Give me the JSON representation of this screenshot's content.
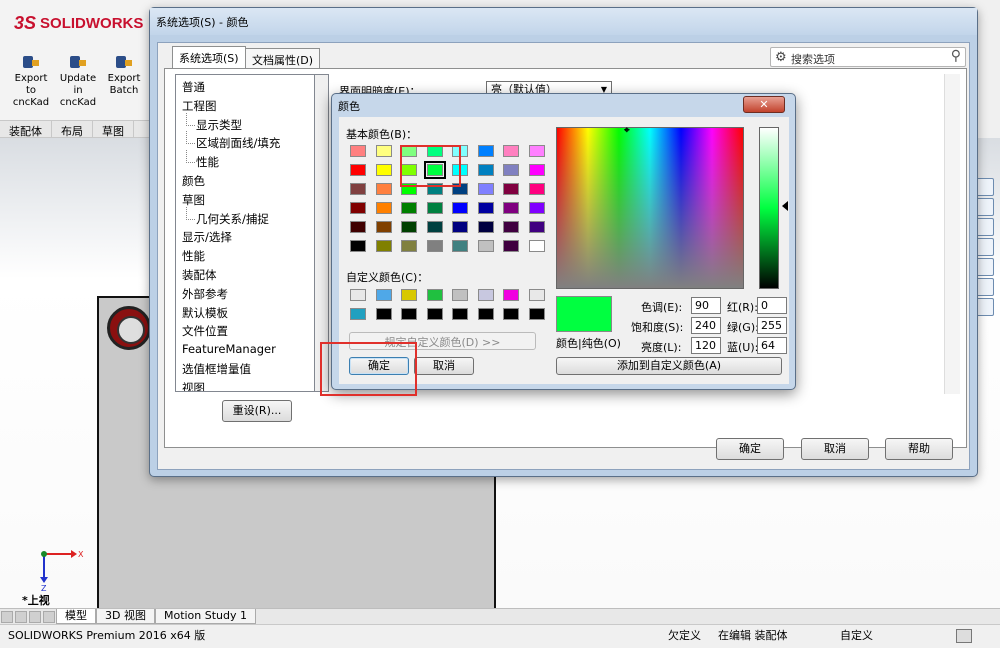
{
  "app": {
    "logo": "SOLIDWORKS",
    "logo_mark": "3S",
    "ribbon_buttons": [
      "Export to cncKad",
      "Update in cncKad",
      "Export Batch"
    ],
    "command_tabs": [
      "装配体",
      "布局",
      "草图"
    ],
    "view_label": "*上视",
    "triad_x": "X",
    "triad_z": "Z",
    "bottom_tabs": [
      "模型",
      "3D 视图",
      "Motion Study 1"
    ],
    "status": {
      "product": "SOLIDWORKS Premium 2016 x64 版",
      "defined": "欠定义",
      "editing": "在编辑 装配体",
      "custom": "自定义"
    }
  },
  "system_options": {
    "title": "系统选项(S) - 颜色",
    "tabs": [
      "系统选项(S)",
      "文档属性(D)"
    ],
    "search_placeholder": "搜索选项",
    "tree": [
      {
        "label": "普通",
        "sub": false
      },
      {
        "label": "工程图",
        "sub": false
      },
      {
        "label": "显示类型",
        "sub": true
      },
      {
        "label": "区域剖面线/填充",
        "sub": true
      },
      {
        "label": "性能",
        "sub": true
      },
      {
        "label": "颜色",
        "sub": false
      },
      {
        "label": "草图",
        "sub": false
      },
      {
        "label": "几何关系/捕捉",
        "sub": true
      },
      {
        "label": "显示/选择",
        "sub": false
      },
      {
        "label": "性能",
        "sub": false
      },
      {
        "label": "装配体",
        "sub": false
      },
      {
        "label": "外部参考",
        "sub": false
      },
      {
        "label": "默认模板",
        "sub": false
      },
      {
        "label": "文件位置",
        "sub": false
      },
      {
        "label": "FeatureManager",
        "sub": false
      },
      {
        "label": "选值框增量值",
        "sub": false
      },
      {
        "label": "视图",
        "sub": false
      }
    ],
    "brightness_label": "界面明暗度(E)：",
    "brightness_value": "亮（默认值）",
    "reset_button": "重设(R)...",
    "ok": "确定",
    "cancel": "取消",
    "help": "帮助"
  },
  "color_dialog": {
    "title": "颜色",
    "close": "✕",
    "basic_label": "基本颜色(B)：",
    "custom_label": "自定义颜色(C)：",
    "define_custom": "规定自定义颜色(D) >>",
    "ok": "确定",
    "cancel": "取消",
    "preview_label": "颜色|纯色(O)",
    "add_custom": "添加到自定义颜色(A)",
    "hue_label": "色调(E):",
    "hue": "90",
    "sat_label": "饱和度(S):",
    "sat": "240",
    "lum_label": "亮度(L):",
    "lum": "120",
    "red_label": "红(R):",
    "red": "0",
    "green_label": "绿(G):",
    "green": "255",
    "blue_label": "蓝(U):",
    "blue": "64",
    "selected_color": "#00ff40",
    "basic_colors": [
      [
        "#ff8080",
        "#ffff80",
        "#80ff80",
        "#00ff80",
        "#80ffff",
        "#0080ff",
        "#ff80c0",
        "#ff80ff"
      ],
      [
        "#ff0000",
        "#ffff00",
        "#80ff00",
        "#00ff40",
        "#00ffff",
        "#0080c0",
        "#8080c0",
        "#ff00ff"
      ],
      [
        "#804040",
        "#ff8040",
        "#00ff00",
        "#008080",
        "#004080",
        "#8080ff",
        "#800040",
        "#ff0080"
      ],
      [
        "#800000",
        "#ff8000",
        "#008000",
        "#008040",
        "#0000ff",
        "#0000a0",
        "#800080",
        "#8000ff"
      ],
      [
        "#400000",
        "#804000",
        "#004000",
        "#004040",
        "#000080",
        "#000040",
        "#400040",
        "#400080"
      ],
      [
        "#000000",
        "#808000",
        "#808040",
        "#808080",
        "#408080",
        "#c0c0c0",
        "#400040",
        "#ffffff"
      ]
    ],
    "custom_colors": [
      [
        "#e8e8e8",
        "#4fa8e8",
        "#d8c800",
        "#20c040",
        "#c0c0c0",
        "#c8c8e0",
        "#f000e0",
        "#e8e8e8"
      ],
      [
        "#20a0c0",
        "#000000",
        "#000000",
        "#000000",
        "#000000",
        "#000000",
        "#000000",
        "#000000"
      ]
    ]
  }
}
